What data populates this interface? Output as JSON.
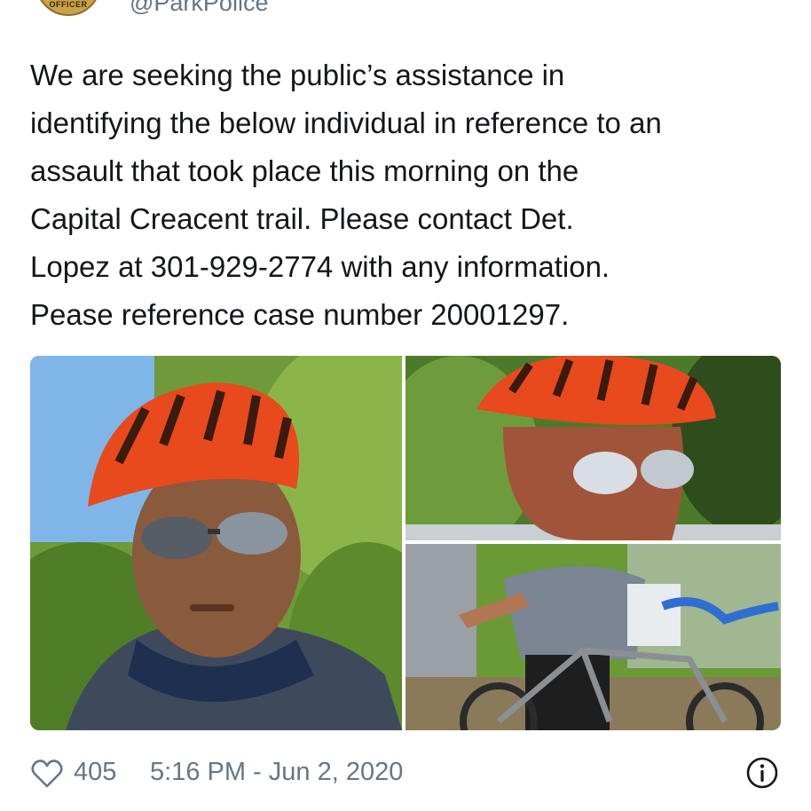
{
  "header": {
    "badge_text": "OFFICER",
    "handle": "@ParkPolice"
  },
  "tweet": {
    "lines": [
      "We are seeking the public’s assistance in",
      "identifying the below individual in reference to an",
      "assault that took place this morning on the",
      "Capital Creacent trail.  Please contact Det.",
      "Lopez at 301-929-2774 with any information.",
      "Pease reference case number 20001297."
    ]
  },
  "media": {
    "photos": [
      "cyclist-closeup-photo",
      "cyclist-helmet-photo",
      "cyclist-bike-photo"
    ],
    "colors": {
      "helmet": "#e8491d",
      "foliage": "#5f8f2e",
      "sky": "#7fb6e8"
    }
  },
  "footer": {
    "heart_icon": "heart-icon",
    "likes": "405",
    "timestamp": "5:16 PM - Jun 2, 2020",
    "info_icon": "info-icon"
  },
  "colors": {
    "text": "#14171a",
    "muted": "#657786"
  }
}
